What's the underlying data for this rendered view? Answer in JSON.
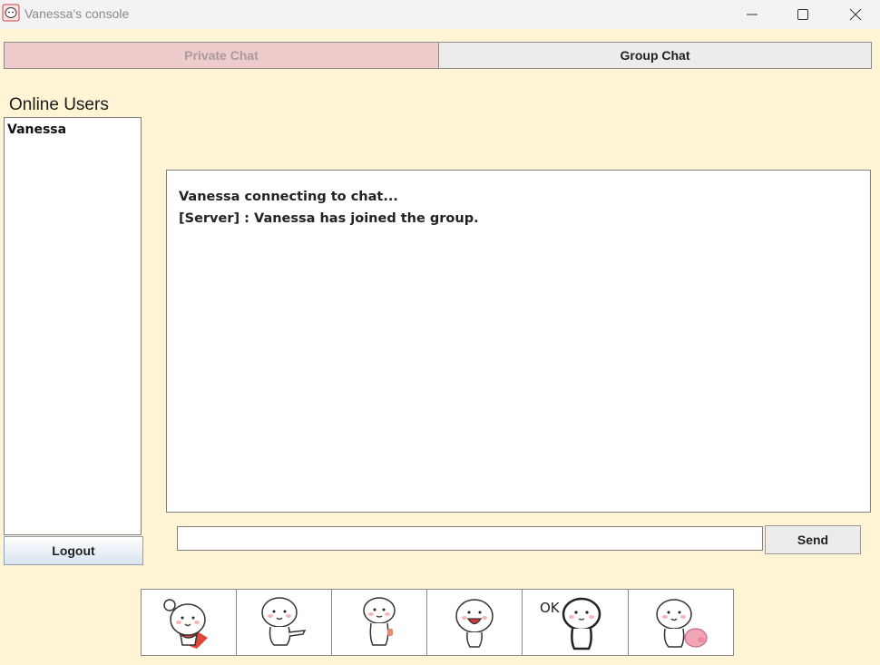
{
  "window": {
    "title": "Vanessa's console",
    "icon": "app-avatar-icon",
    "controls": [
      "minimize-icon",
      "maximize-icon",
      "close-icon"
    ]
  },
  "tabs": [
    {
      "label": "Private Chat",
      "state": "disabled"
    },
    {
      "label": "Group Chat",
      "state": "active"
    }
  ],
  "sidebar": {
    "title": "Online Users",
    "users": [
      "Vanessa"
    ],
    "logout_label": "Logout"
  },
  "chat": {
    "messages": [
      "Vanessa connecting to chat...",
      "[Server] : Vanessa has joined the group."
    ],
    "input_value": "",
    "send_label": "Send"
  },
  "stickers": [
    {
      "name": "sticker-wave-cape"
    },
    {
      "name": "sticker-pointing"
    },
    {
      "name": "sticker-shy-standing"
    },
    {
      "name": "sticker-laughing"
    },
    {
      "name": "sticker-ok"
    },
    {
      "name": "sticker-with-pig"
    }
  ],
  "colors": {
    "window_background": "#fff5d4",
    "private_tab": "#efcccc",
    "group_tab": "#ececec"
  }
}
